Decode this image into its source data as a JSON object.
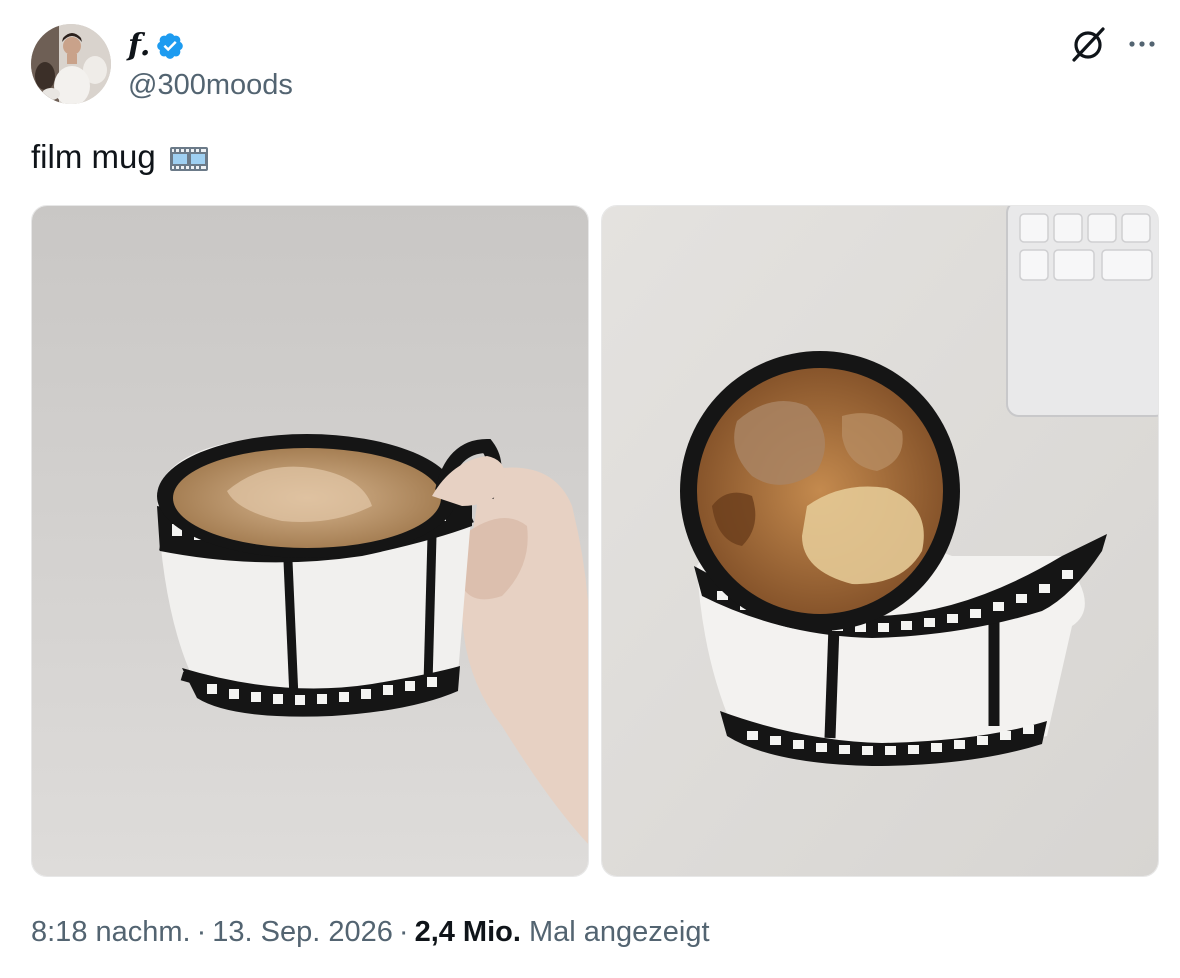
{
  "author": {
    "display_name": "f.",
    "handle": "@300moods",
    "verified": true,
    "verified_color": "#1d9bf0"
  },
  "header_actions": {
    "grok_icon": "grok-icon",
    "more_icon": "more-horizontal-icon"
  },
  "tweet": {
    "text": "film mug",
    "emoji": "film-frames-emoji"
  },
  "media": [
    {
      "icon": "photo-film-mug-held"
    },
    {
      "icon": "photo-film-mug-on-desk"
    }
  ],
  "meta": {
    "time": "8:18 nachm.",
    "separator": "·",
    "date": "13. Sep. 2026",
    "views_count": "2,4 Mio.",
    "views_label": "Mal angezeigt"
  },
  "colors": {
    "text_primary": "#0f1419",
    "text_secondary": "#536471",
    "background": "#ffffff"
  }
}
